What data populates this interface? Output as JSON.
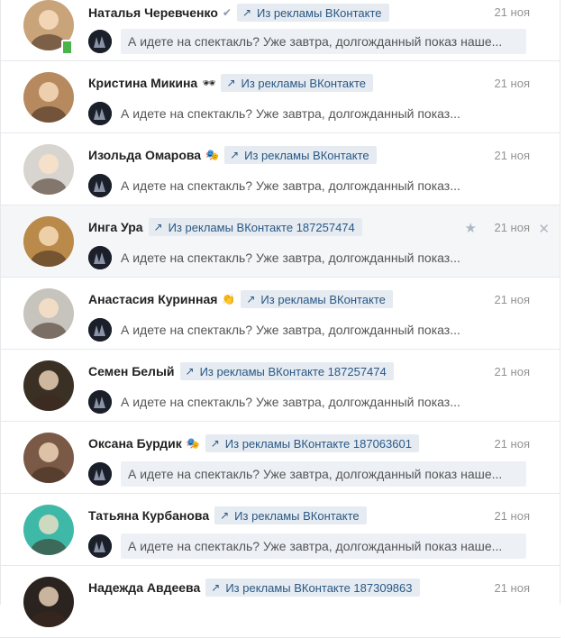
{
  "dialogs": [
    {
      "name": "Наталья Черевченко",
      "badge": "✔",
      "tag": "Из рекламы ВКонтакте",
      "date": "21 ноя",
      "message": "А идете на спектакль? Уже завтра, долгожданный показ наше...",
      "unread": true,
      "avatar_color": "#c9a37a",
      "online_mobile": true
    },
    {
      "name": "Кристина Микина",
      "badge": "🕶",
      "tag": "Из рекламы ВКонтакте",
      "date": "21 ноя",
      "message": "А идете на спектакль? Уже завтра, долгожданный показ...",
      "unread": false,
      "avatar_color": "#b68a5e"
    },
    {
      "name": "Изольда Омарова",
      "badge": "🎭",
      "tag": "Из рекламы ВКонтакте",
      "date": "21 ноя",
      "message": "А идете на спектакль? Уже завтра, долгожданный показ...",
      "unread": false,
      "avatar_color": "#d8d4cf"
    },
    {
      "name": "Инга Ура",
      "badge": "",
      "tag": "Из рекламы ВКонтакте 187257474",
      "date": "21 ноя",
      "message": "А идете на спектакль? Уже завтра, долгожданный показ...",
      "unread": false,
      "highlight": true,
      "avatar_color": "#b98a4a"
    },
    {
      "name": "Анастасия Куринная",
      "badge": "👏",
      "tag": "Из рекламы ВКонтакте",
      "date": "21 ноя",
      "message": "А идете на спектакль? Уже завтра, долгожданный показ...",
      "unread": false,
      "avatar_color": "#c7c3bd"
    },
    {
      "name": "Семен Белый",
      "badge": "",
      "tag": "Из рекламы ВКонтакте 187257474",
      "date": "21 ноя",
      "message": "А идете на спектакль? Уже завтра, долгожданный показ...",
      "unread": false,
      "avatar_color": "#3a3024"
    },
    {
      "name": "Оксана Бурдик",
      "badge": "🎭",
      "tag": "Из рекламы ВКонтакте 187063601",
      "date": "21 ноя",
      "message": "А идете на спектакль? Уже завтра, долгожданный показ наше...",
      "unread": true,
      "avatar_color": "#7a5a46"
    },
    {
      "name": "Татьяна Курбанова",
      "badge": "",
      "tag": "Из рекламы ВКонтакте",
      "date": "21 ноя",
      "message": "А идете на спектакль? Уже завтра, долгожданный показ наше...",
      "unread": true,
      "avatar_color": "#3fb9a7"
    },
    {
      "name": "Надежда Авдеева",
      "badge": "",
      "tag": "Из рекламы ВКонтакте 187309863",
      "date": "21 ноя",
      "message": "",
      "unread": false,
      "avatar_color": "#2b2320"
    }
  ],
  "colors": {
    "tag_bg": "#e5ebf1",
    "tag_text": "#2a5885",
    "unread_bg": "#edf0f5",
    "highlight_bg": "#f5f6f8"
  },
  "icons": {
    "tag_arrow": "↗",
    "star": "★",
    "close": "✕"
  }
}
